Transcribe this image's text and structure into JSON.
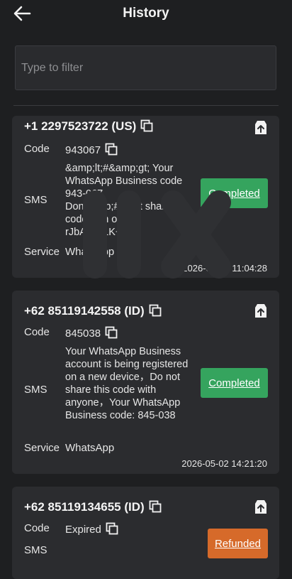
{
  "header": {
    "title": "History",
    "back_icon": "arrow-left-icon"
  },
  "filter": {
    "placeholder": "Type to filter",
    "value": ""
  },
  "labels": {
    "code": "Code",
    "sms": "SMS",
    "service": "Service"
  },
  "records": [
    {
      "phone": "+1 2297523722 (US)",
      "code": "943067",
      "sms": "&amp;lt;#&amp;gt; Your WhatsApp Business code 943-067\nDon&amp;#039;t share this code with others\nrJbA/XP1K+V",
      "status": "Completed",
      "service": "WhatsApp",
      "timestamp": "2026-05-07 11:04:28"
    },
    {
      "phone": "+62 85119142558 (ID)",
      "code": "845038",
      "sms": "Your WhatsApp Business account is being registered on a new device，Do not share this code with anyone，Your WhatsApp Business code: 845-038",
      "status": "Completed",
      "service": "WhatsApp",
      "timestamp": "2026-05-02 14:21:20"
    },
    {
      "phone": "+62 85119134655 (ID)",
      "code": "Expired",
      "sms": "",
      "status": "Refunded"
    }
  ],
  "colors": {
    "completed": "#35a45e",
    "refunded": "#d66a2a",
    "card": "#2b2c2f",
    "background": "#1e1f21"
  }
}
